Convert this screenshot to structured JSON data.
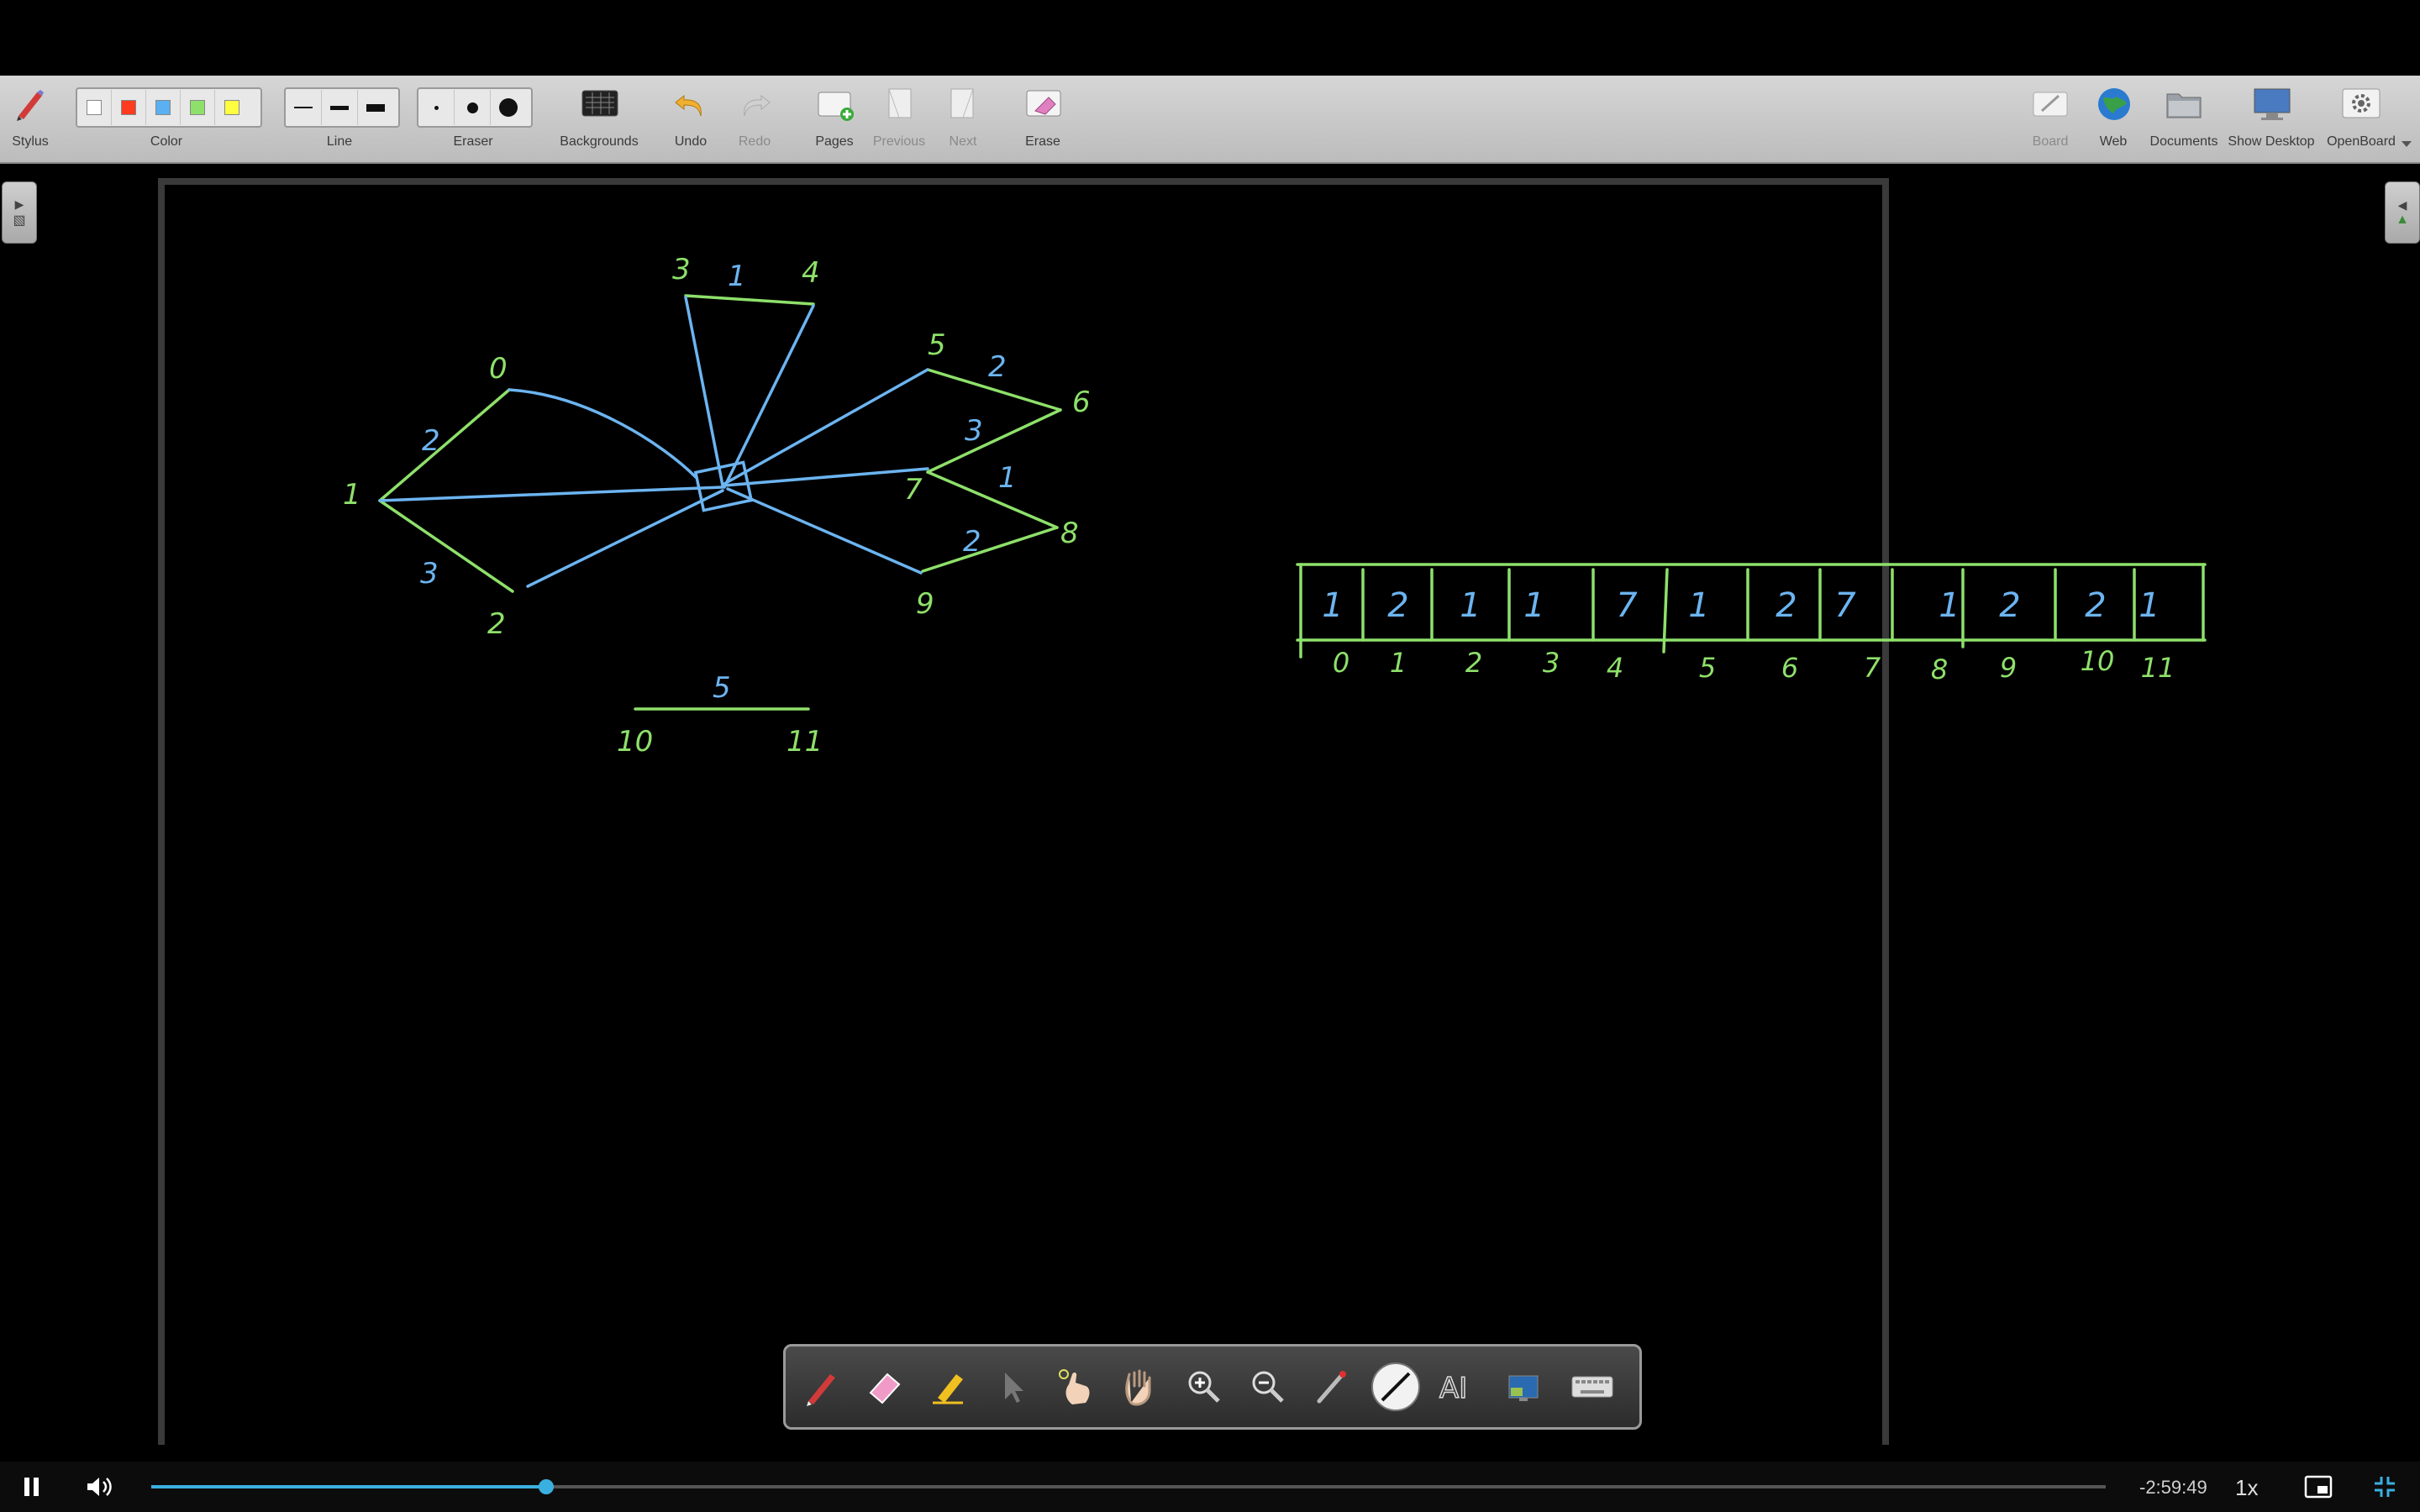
{
  "toolbar": {
    "stylus": "Stylus",
    "color": "Color",
    "line": "Line",
    "eraser": "Eraser",
    "backgrounds": "Backgrounds",
    "undo": "Undo",
    "redo": "Redo",
    "pages": "Pages",
    "previous": "Previous",
    "next": "Next",
    "erase": "Erase",
    "board": "Board",
    "web": "Web",
    "documents": "Documents",
    "show_desktop": "Show Desktop",
    "openboard": "OpenBoard",
    "colors": [
      "#ffffff",
      "#ff3b1f",
      "#5ab0f0",
      "#8ee06a",
      "#ffff40"
    ]
  },
  "drawing": {
    "tree_node_labels": [
      "0",
      "1",
      "2",
      "3",
      "4",
      "5",
      "6",
      "7",
      "8",
      "9",
      "10",
      "11"
    ],
    "tree_weights": [
      "2",
      "3",
      "1",
      "2",
      "3",
      "1",
      "2",
      "5"
    ],
    "array_values": [
      "1",
      "2",
      "1",
      "1",
      "7",
      "1",
      "2",
      "7",
      "1",
      "2",
      "2",
      "1"
    ],
    "array_indices": [
      "0",
      "1",
      "2",
      "3",
      "4",
      "5",
      "6",
      "7",
      "8",
      "9",
      "10",
      "11"
    ],
    "green": "#8ee06a",
    "blue": "#6cb4f0"
  },
  "video": {
    "time_remaining": "-2:59:49",
    "speed": "1x",
    "progress": 0.202
  }
}
